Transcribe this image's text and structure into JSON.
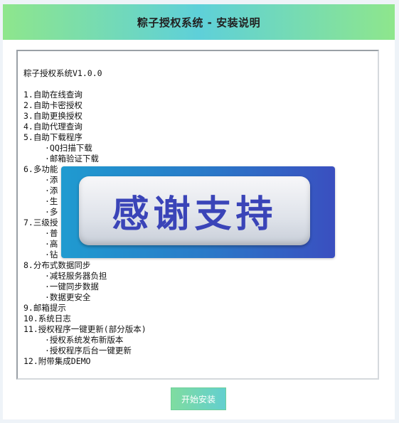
{
  "header": {
    "title": "粽子授权系统 - 安装说明"
  },
  "readme": {
    "lines": [
      {
        "text": "粽子授权系统V1.0.0",
        "sub": false
      },
      {
        "text": "",
        "sub": false
      },
      {
        "text": "1.自助在线查询",
        "sub": false
      },
      {
        "text": "2.自助卡密授权",
        "sub": false
      },
      {
        "text": "3.自助更换授权",
        "sub": false
      },
      {
        "text": "4.自助代理查询",
        "sub": false
      },
      {
        "text": "5.自助下载程序",
        "sub": false
      },
      {
        "text": "·QQ扫描下载",
        "sub": true
      },
      {
        "text": "·邮箱验证下载",
        "sub": true
      },
      {
        "text": "6.多功能",
        "sub": false
      },
      {
        "text": "·添",
        "sub": true
      },
      {
        "text": "·添",
        "sub": true
      },
      {
        "text": "·生",
        "sub": true
      },
      {
        "text": "·多",
        "sub": true
      },
      {
        "text": "7.三级授",
        "sub": false
      },
      {
        "text": "·普",
        "sub": true
      },
      {
        "text": "·高",
        "sub": true
      },
      {
        "text": "·钻",
        "sub": true
      },
      {
        "text": "8.分布式数据同步",
        "sub": false
      },
      {
        "text": "·减轻服务器负担",
        "sub": true
      },
      {
        "text": "·一键同步数据",
        "sub": true
      },
      {
        "text": "·数据更安全",
        "sub": true
      },
      {
        "text": "9.邮箱提示",
        "sub": false
      },
      {
        "text": "10.系统日志",
        "sub": false
      },
      {
        "text": "11.授权程序一键更新(部分版本)",
        "sub": false
      },
      {
        "text": "·授权系统发布新版本",
        "sub": true
      },
      {
        "text": "·授权程序后台一键更新",
        "sub": true
      },
      {
        "text": "12.附带集成DEMO",
        "sub": false
      }
    ]
  },
  "overlay": {
    "text": "感谢支持",
    "text_color": "#3a44b8"
  },
  "actions": {
    "start_label": "开始安装"
  },
  "colors": {
    "header_gradient_start": "#8ee68c",
    "header_gradient_mid": "#5ed0d9",
    "button_gradient_start": "#7fdca0",
    "button_gradient_end": "#63cfcf"
  }
}
